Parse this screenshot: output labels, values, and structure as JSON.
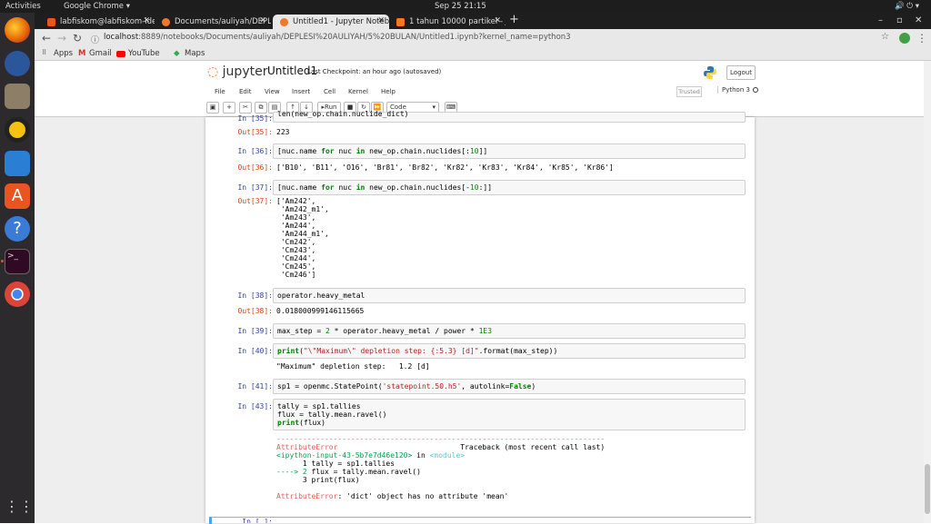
{
  "system": {
    "activities": "Activities",
    "app": "Google Chrome",
    "clock": "Sep 25  21:15"
  },
  "tabs": [
    {
      "title": "labfiskom@labfiskom-ide"
    },
    {
      "title": "Documents/auliyah/DEPLE"
    },
    {
      "title": "Untitled1 - Jupyter Noteb"
    },
    {
      "title": "1 tahun 10000 partikel - Ju"
    }
  ],
  "address": {
    "host": "localhost",
    "path": ":8889/notebooks/Documents/auliyah/DEPLESI%20AULIYAH/5%20BULAN/Untitled1.ipynb?kernel_name=python3"
  },
  "bookmarks": [
    "Apps",
    "Gmail",
    "YouTube",
    "Maps"
  ],
  "jupyter": {
    "logo": "jupyter",
    "title": "Untitled1",
    "checkpoint": "Last Checkpoint: an hour ago  (autosaved)",
    "logout": "Logout",
    "menu": [
      "File",
      "Edit",
      "View",
      "Insert",
      "Cell",
      "Kernel",
      "Help"
    ],
    "trusted": "Trusted",
    "kernel": "Python 3",
    "run_label": "Run",
    "cell_type": "Code"
  },
  "cells": {
    "c35_in_prompt": "In [35]:",
    "c35_in": "len(new_op.chain.nuclide_dict)",
    "c35_out_prompt": "Out[35]:",
    "c35_out": "223",
    "c36_in_prompt": "In [36]:",
    "c36_out_prompt": "Out[36]:",
    "c36_out": "['B10', 'B11', 'O16', 'Br81', 'Br82', 'Kr82', 'Kr83', 'Kr84', 'Kr85', 'Kr86']",
    "c37_in_prompt": "In [37]:",
    "c37_out_prompt": "Out[37]:",
    "c37_out": "['Am242',\n 'Am242_m1',\n 'Am243',\n 'Am244',\n 'Am244_m1',\n 'Cm242',\n 'Cm243',\n 'Cm244',\n 'Cm245',\n 'Cm246']",
    "c38_in_prompt": "In [38]:",
    "c38_in": "operator.heavy_metal",
    "c38_out_prompt": "Out[38]:",
    "c38_out": "0.018000999146115665",
    "c39_in_prompt": "In [39]:",
    "c40_in_prompt": "In [40]:",
    "c40_out": "\"Maximum\" depletion step:   1.2 [d]",
    "c41_in_prompt": "In [41]:",
    "c43_in_prompt": "In [43]:",
    "last_prompt": "In [ ]:"
  },
  "error": {
    "dashes": "---------------------------------------------------------------------------",
    "name": "AttributeError",
    "traceback_label": "Traceback (most recent call last)",
    "input_ref": "<ipython-input-43-5b7e7d46e120>",
    "in_word": " in ",
    "module": "<module>",
    "line1": "      1 tally = sp1.tallies",
    "arrow": "----> 2 ",
    "line2": "flux = tally.mean.ravel()",
    "line3": "      3 print(flux)",
    "message": ": 'dict' object has no attribute 'mean'"
  }
}
